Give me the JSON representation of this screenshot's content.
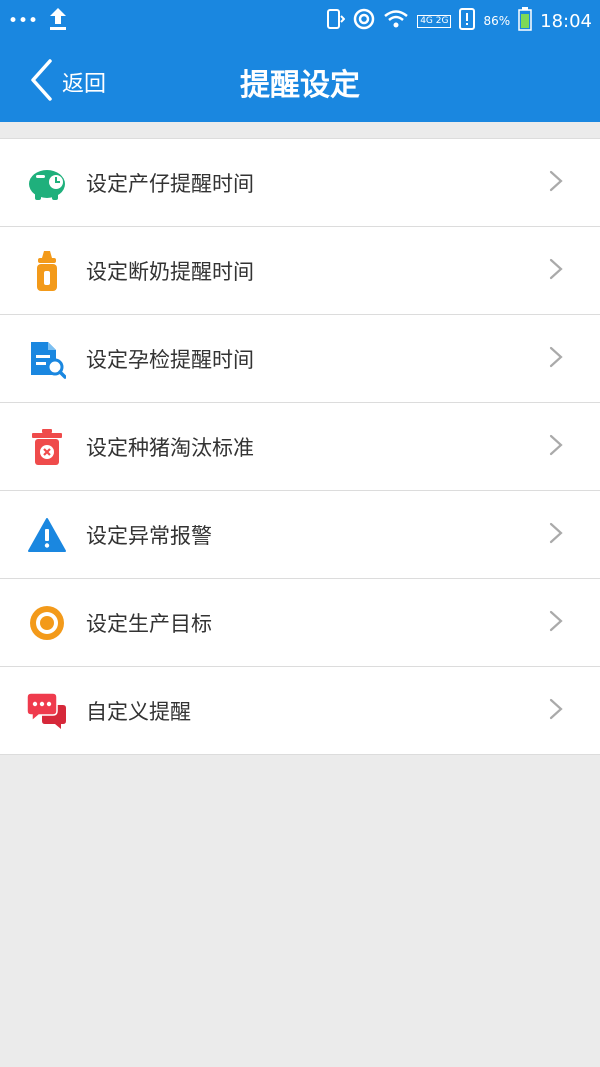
{
  "statusbar": {
    "battery": "86%",
    "time": "18:04",
    "network": "4G 2G"
  },
  "header": {
    "back_label": "返回",
    "title": "提醒设定"
  },
  "colors": {
    "primary": "#1a87e0",
    "green": "#1fb07c",
    "orange": "#f39a1a",
    "blue": "#1a87e0",
    "red": "#ef4b4b",
    "crimson": "#d6283a"
  },
  "menu": {
    "items": [
      {
        "label": "设定产仔提醒时间",
        "icon": "piggy-bank-icon"
      },
      {
        "label": "设定断奶提醒时间",
        "icon": "baby-bottle-icon"
      },
      {
        "label": "设定孕检提醒时间",
        "icon": "document-search-icon"
      },
      {
        "label": "设定种猪淘汰标准",
        "icon": "trash-delete-icon"
      },
      {
        "label": "设定异常报警",
        "icon": "warning-icon"
      },
      {
        "label": "设定生产目标",
        "icon": "target-icon"
      },
      {
        "label": "自定义提醒",
        "icon": "chat-bubbles-icon"
      }
    ]
  }
}
